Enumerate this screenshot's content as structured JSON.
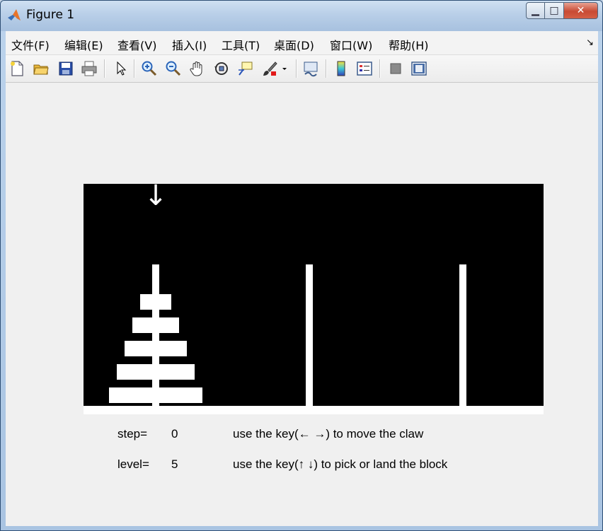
{
  "window": {
    "title": "Figure 1",
    "buttons": {
      "minimize": "▁",
      "maximize": "□",
      "close": "✕"
    }
  },
  "menubar": {
    "items": [
      "文件(F)",
      "编辑(E)",
      "查看(V)",
      "插入(I)",
      "工具(T)",
      "桌面(D)",
      "窗口(W)",
      "帮助(H)"
    ],
    "overflow_icon": "dock-arrow-icon"
  },
  "toolbar": {
    "icons": [
      "new-figure-icon",
      "open-file-icon",
      "save-icon",
      "print-icon",
      "pointer-icon",
      "zoom-in-icon",
      "zoom-out-icon",
      "pan-hand-icon",
      "rotate-3d-icon",
      "data-cursor-icon",
      "brush-icon",
      "brush-dropdown-icon",
      "link-plot-icon",
      "colorbar-icon",
      "legend-icon",
      "hide-plot-tools-icon",
      "show-plot-tools-icon"
    ]
  },
  "game": {
    "claw_symbol": "↓",
    "claw_position": 1,
    "poles": 3,
    "pole_1_blocks_top_to_bottom": [
      1,
      2,
      3,
      4,
      5
    ],
    "pole_2_blocks_top_to_bottom": [],
    "pole_3_blocks_top_to_bottom": [],
    "colors": {
      "background": "#000000",
      "blocks": "#ffffff",
      "figure_bg": "#f0f0f0"
    }
  },
  "status": {
    "step_label": "step=",
    "step_value": "0",
    "level_label": "level=",
    "level_value": "5",
    "hint_move": "use the key(← →) to move the claw",
    "hint_pick": "use the key(↑ ↓) to pick or land the block"
  }
}
